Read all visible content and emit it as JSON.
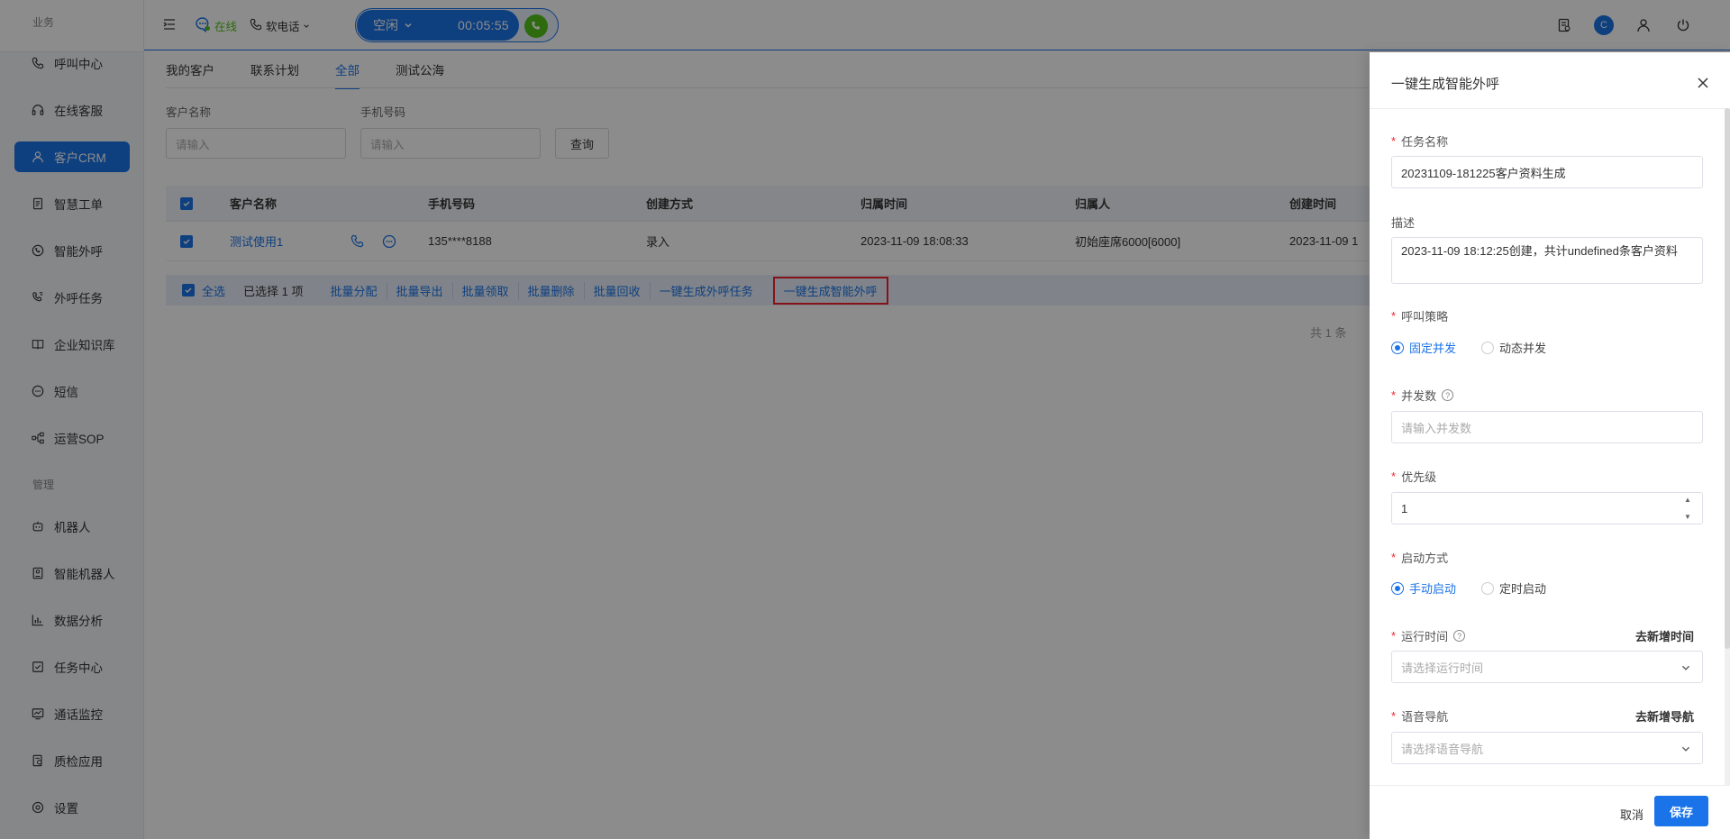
{
  "sidebar": {
    "section_business": "业务",
    "section_manage": "管理",
    "items": [
      {
        "label": "呼叫中心",
        "icon": "phone-icon"
      },
      {
        "label": "在线客服",
        "icon": "headset-icon"
      },
      {
        "label": "客户CRM",
        "icon": "user-icon"
      },
      {
        "label": "智慧工单",
        "icon": "document-icon"
      },
      {
        "label": "智能外呼",
        "icon": "phone-circle-icon"
      },
      {
        "label": "外呼任务",
        "icon": "phone-list-icon"
      },
      {
        "label": "企业知识库",
        "icon": "book-icon"
      },
      {
        "label": "短信",
        "icon": "sms-icon"
      },
      {
        "label": "运营SOP",
        "icon": "flow-icon"
      },
      {
        "label": "机器人",
        "icon": "robot-icon"
      },
      {
        "label": "智能机器人",
        "icon": "smart-robot-icon"
      },
      {
        "label": "数据分析",
        "icon": "chart-icon"
      },
      {
        "label": "任务中心",
        "icon": "task-icon"
      },
      {
        "label": "通话监控",
        "icon": "monitor-icon"
      },
      {
        "label": "质检应用",
        "icon": "quality-icon"
      },
      {
        "label": "设置",
        "icon": "settings-icon"
      }
    ]
  },
  "header": {
    "status_label": "在线",
    "phone_mode": "软电话",
    "call_state": "空闲",
    "call_timer": "00:05:55",
    "avatar_letter": "C"
  },
  "main": {
    "tabs": [
      "我的客户",
      "联系计划",
      "全部",
      "测试公海"
    ],
    "active_tab": 2,
    "filters": {
      "name_label": "客户名称",
      "name_placeholder": "请输入",
      "phone_label": "手机号码",
      "phone_placeholder": "请输入",
      "query_button": "查询"
    },
    "table": {
      "columns": [
        "客户名称",
        "手机号码",
        "创建方式",
        "归属时间",
        "归属人",
        "创建时间"
      ],
      "rows": [
        {
          "name": "测试使用1",
          "phone": "135****8188",
          "create_method": "录入",
          "assign_time": "2023-11-09 18:08:33",
          "owner": "初始座席6000[6000]",
          "create_time": "2023-11-09 1"
        }
      ]
    },
    "batch_bar": {
      "select_all": "全选",
      "selected_text": "已选择 1 项",
      "actions": [
        "批量分配",
        "批量导出",
        "批量领取",
        "批量删除",
        "批量回收",
        "一键生成外呼任务"
      ],
      "highlight_action": "一键生成智能外呼"
    },
    "pager_total": "共 1 条"
  },
  "drawer": {
    "title": "一键生成智能外呼",
    "task_name_label": "任务名称",
    "task_name_value": "20231109-181225客户资料生成",
    "desc_label": "描述",
    "desc_value": "2023-11-09 18:12:25创建，共计undefined条客户资料",
    "strategy_label": "呼叫策略",
    "strategy_options": [
      "固定并发",
      "动态并发"
    ],
    "concurrency_label": "并发数",
    "concurrency_placeholder": "请输入并发数",
    "priority_label": "优先级",
    "priority_value": "1",
    "start_mode_label": "启动方式",
    "start_mode_options": [
      "手动启动",
      "定时启动"
    ],
    "run_time_label": "运行时间",
    "run_time_link": "去新增时间",
    "run_time_placeholder": "请选择运行时间",
    "voice_nav_label": "语音导航",
    "voice_nav_link": "去新增导航",
    "voice_nav_placeholder": "请选择语音导航",
    "cancel_button": "取消",
    "save_button": "保存"
  },
  "colors": {
    "primary": "#1a73e8",
    "online": "#52c41a",
    "highlight_border": "#f5222d"
  }
}
